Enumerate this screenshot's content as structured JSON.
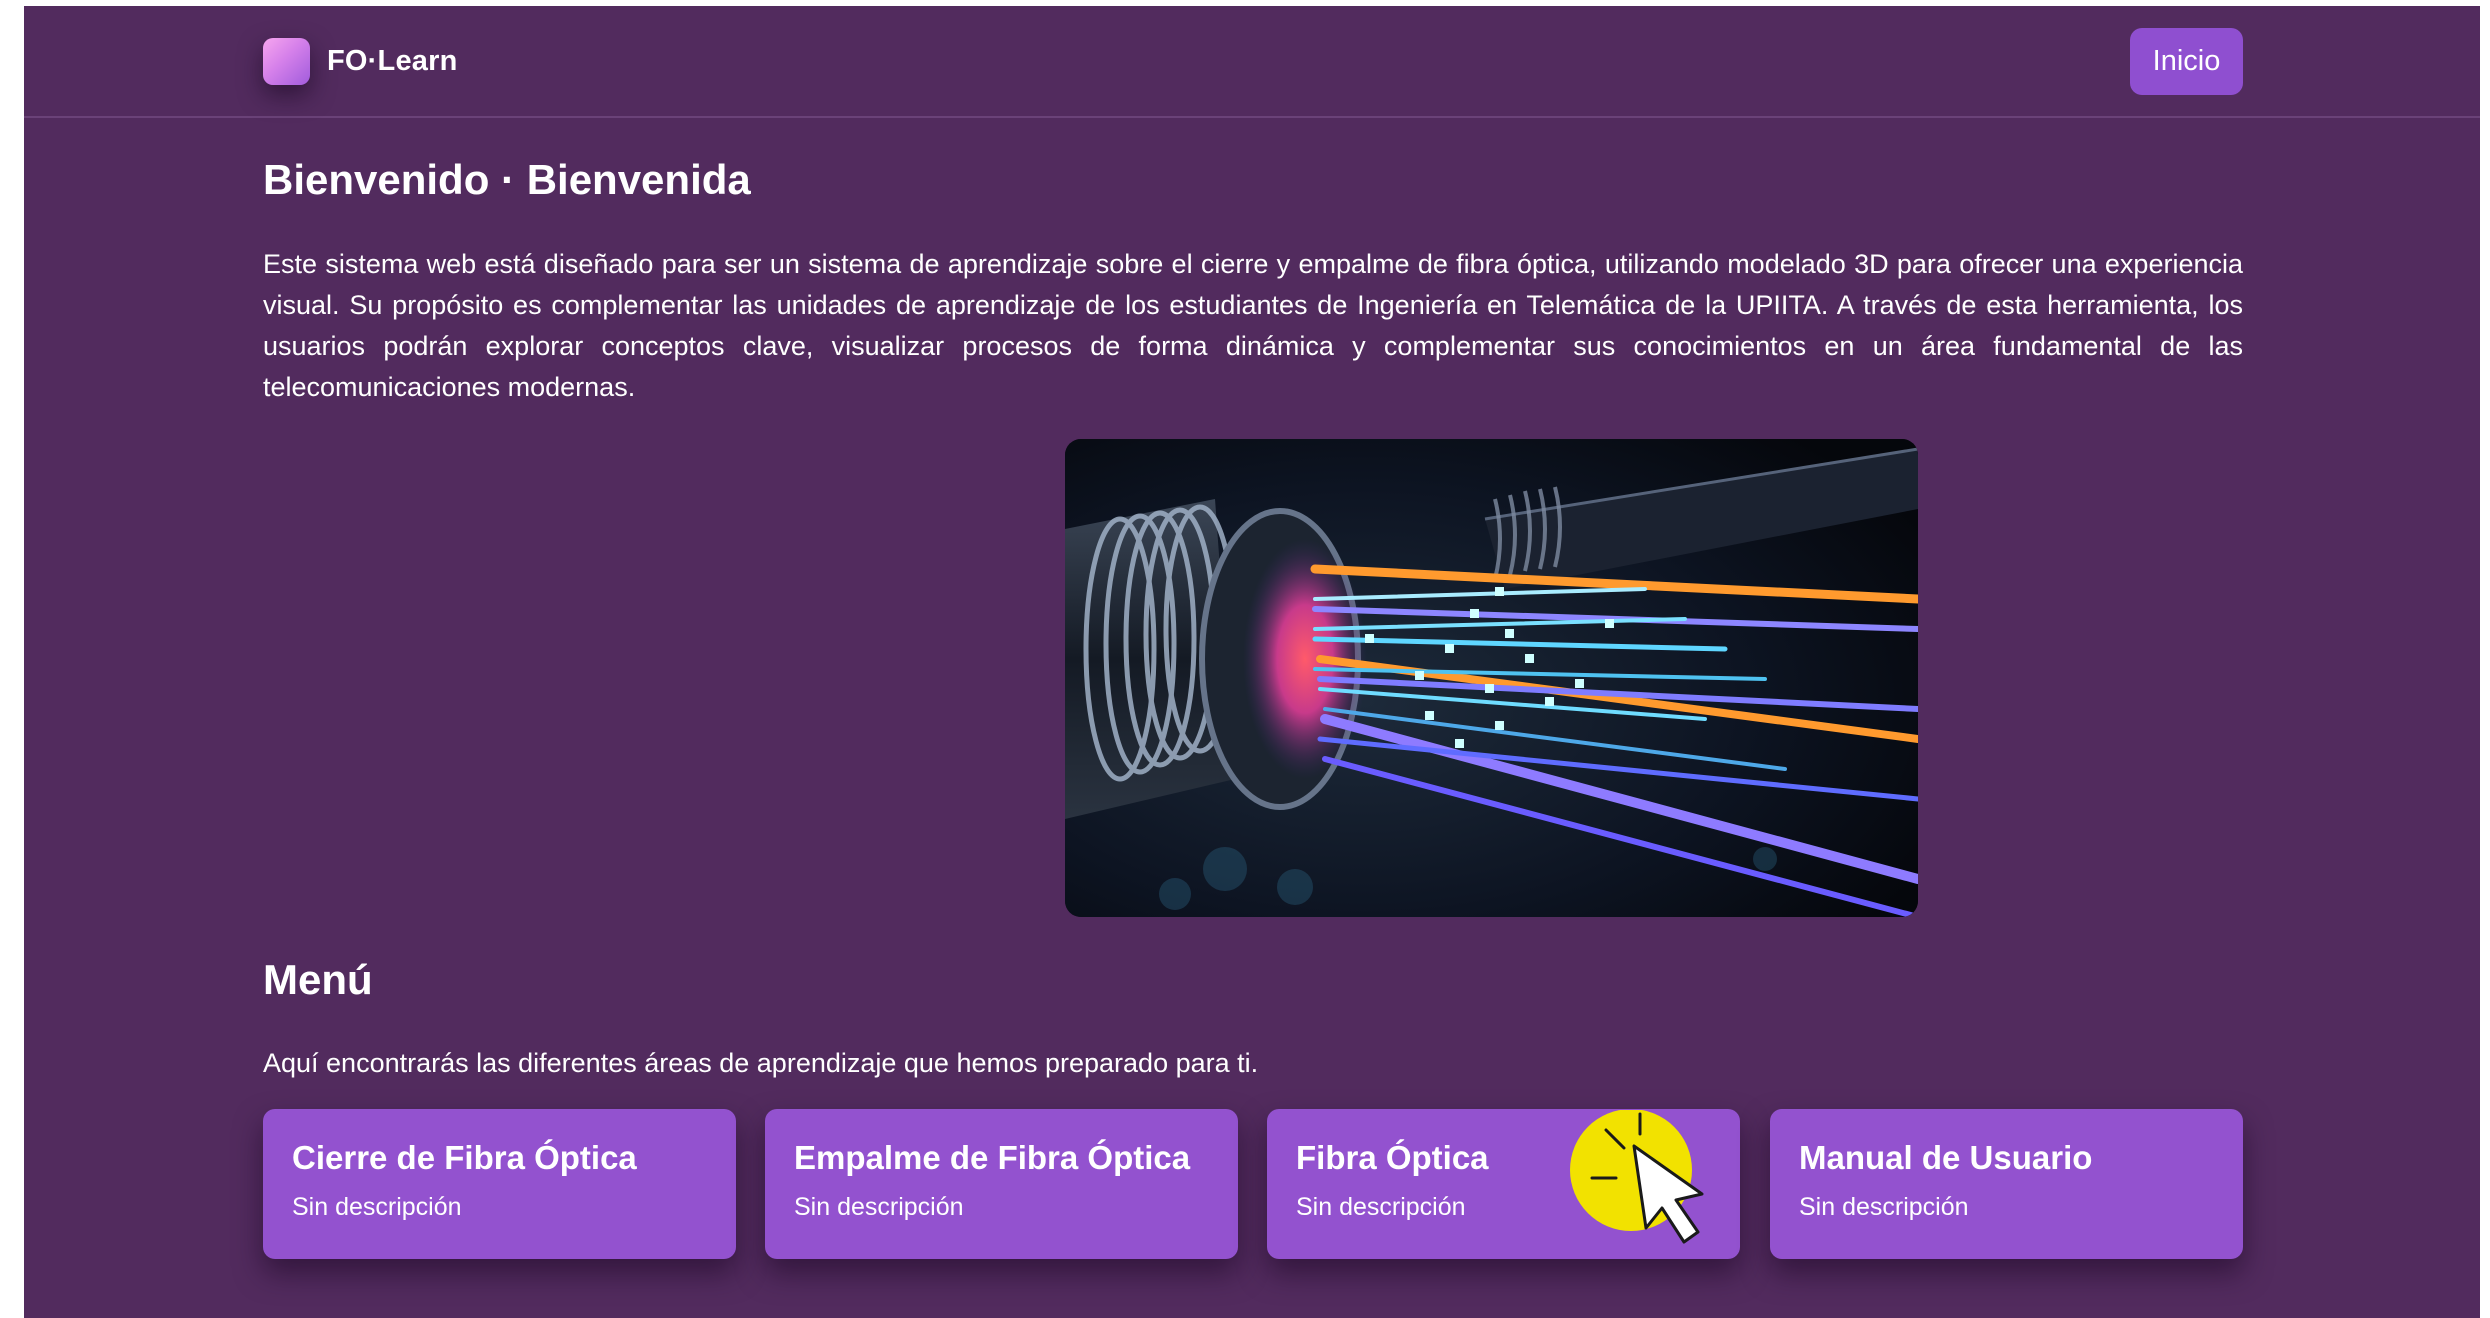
{
  "app": {
    "brand_name": "FO·Learn",
    "logo": "gradient-square-logo"
  },
  "nav": {
    "inicio_label": "Inicio"
  },
  "welcome": {
    "title": "Bienvenido · Bienvenida",
    "body": "Este sistema web está diseñado para ser un sistema de aprendizaje sobre el cierre y empalme de fibra óptica, utilizando modelado 3D para ofrecer una experiencia visual. Su propósito es complementar las unidades de aprendizaje de los estudiantes de Ingeniería en Telemática de la UPIITA. A través de esta herramienta, los usuarios podrán explorar conceptos clave, visualizar procesos de forma dinámica y complementar sus conocimientos en un área fundamental de las telecomunicaciones modernas.",
    "hero_image": "fiber-optic-cable-image"
  },
  "menu": {
    "title": "Menú",
    "subtitle": "Aquí encontrarás las diferentes áreas de aprendizaje que hemos preparado para ti.",
    "cards": [
      {
        "title": "Cierre de Fibra Óptica",
        "description": "Sin descripción"
      },
      {
        "title": "Empalme de Fibra Óptica",
        "description": "Sin descripción"
      },
      {
        "title": "Fibra Óptica",
        "description": "Sin descripción"
      },
      {
        "title": "Manual de Usuario",
        "description": "Sin descripción"
      }
    ]
  },
  "overlay": {
    "cursor": "click-cursor-icon",
    "highlight_color": "#f2e200"
  },
  "colors": {
    "background": "#522b5e",
    "accent": "#9352cf",
    "button": "#8f4fd0",
    "text": "#ffffff"
  }
}
